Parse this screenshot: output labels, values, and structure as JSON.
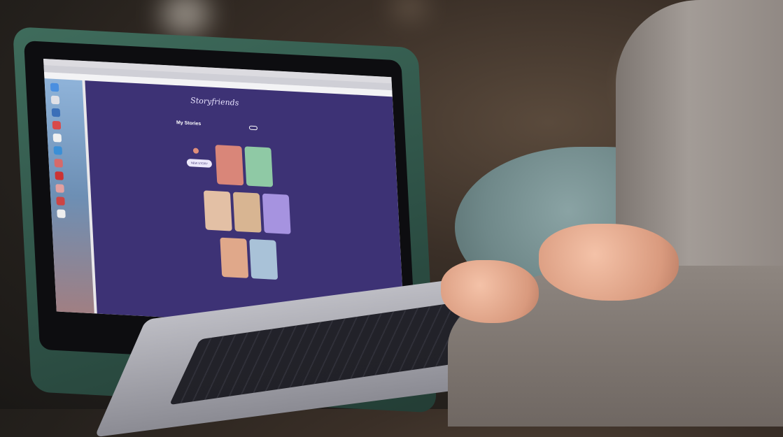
{
  "app": {
    "page_title": "My Stories",
    "subtitle": "",
    "new_story_label": "NEW STORY",
    "pill_label": "",
    "logo_text": "Storyfriends"
  },
  "colors": {
    "app_background": "#3d3275",
    "card_colors": [
      "#d98679",
      "#8fc9a5",
      "#e3c0a5",
      "#d8b592",
      "#a693e0",
      "#e0a88a",
      "#a9c2d8"
    ]
  }
}
